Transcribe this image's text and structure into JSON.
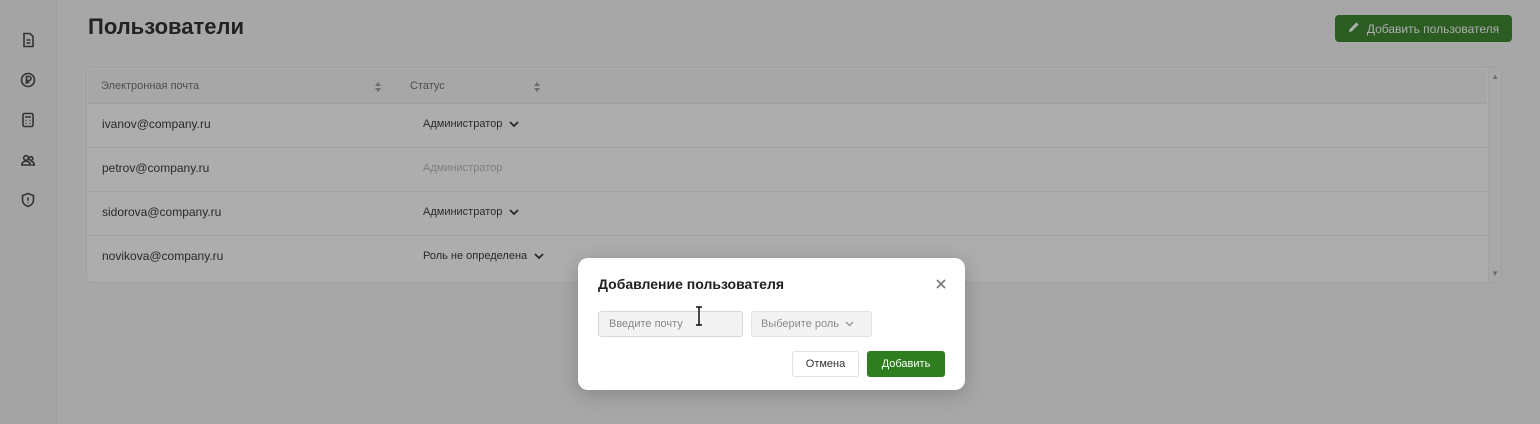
{
  "page": {
    "title": "Пользователи",
    "add_user_button": "Добавить пользователя"
  },
  "sidebar": {
    "icons": [
      "document-icon",
      "ruble-icon",
      "calculator-icon",
      "users-icon",
      "shield-icon"
    ]
  },
  "table": {
    "columns": [
      "Электронная почта",
      "Статус"
    ],
    "rows": [
      {
        "email": "ivanov@company.ru",
        "role": "Администратор",
        "editable": true
      },
      {
        "email": "petrov@company.ru",
        "role": "Администратор",
        "editable": false
      },
      {
        "email": "sidorova@company.ru",
        "role": "Администратор",
        "editable": true
      },
      {
        "email": "novikova@company.ru",
        "role": "Роль не определена",
        "editable": true
      }
    ]
  },
  "modal": {
    "title": "Добавление пользователя",
    "email_placeholder": "Введите почту",
    "email_value": "",
    "role_placeholder": "Выберите роль",
    "cancel_label": "Отмена",
    "confirm_label": "Добавить"
  },
  "colors": {
    "accent": "#2e7d1f",
    "overlay": "rgba(40,40,40,0.38)"
  }
}
